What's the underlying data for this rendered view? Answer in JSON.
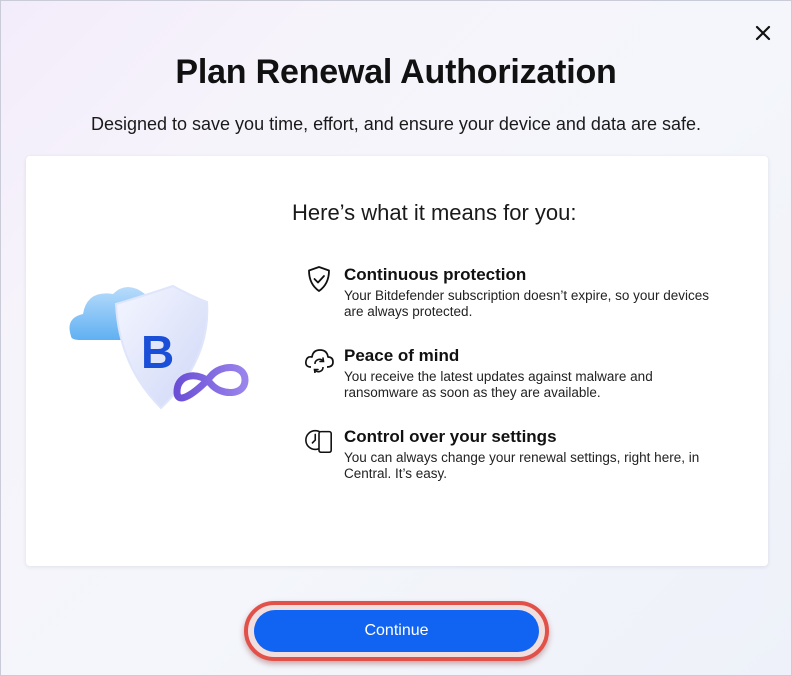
{
  "dialog": {
    "title": "Plan Renewal Authorization",
    "subtitle": "Designed to save you time, effort, and ensure your device and data are safe.",
    "close_icon": "close-icon"
  },
  "card": {
    "heading": "Here’s what it means for you:",
    "illustration_letter": "B",
    "features": [
      {
        "icon": "shield-check-icon",
        "title": "Continuous protection",
        "desc_line1": "Your Bitdefender subscription doesn’t expire, so your devices",
        "desc_line2": "are always protected."
      },
      {
        "icon": "cloud-sync-icon",
        "title": "Peace of mind",
        "desc_line1": "You receive the latest updates against malware and",
        "desc_line2": "ransomware as soon as they are available."
      },
      {
        "icon": "clock-device-icon",
        "title": "Control over your settings",
        "desc_line1": "You can always change your renewal settings, right here, in",
        "desc_line2": "Central. It’s easy."
      }
    ]
  },
  "actions": {
    "continue_label": "Continue"
  },
  "colors": {
    "primary_button": "#1164f2",
    "highlight_ring": "#e2504a"
  }
}
